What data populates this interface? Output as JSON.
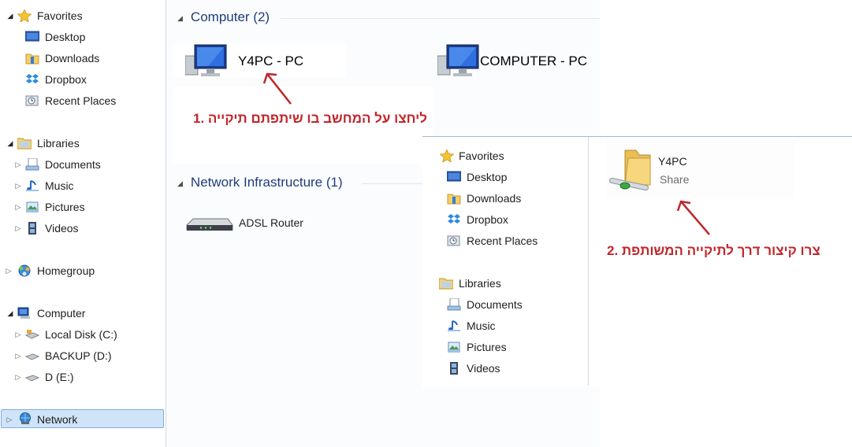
{
  "nav": {
    "favorites": {
      "label": "Favorites",
      "items": [
        "Desktop",
        "Downloads",
        "Dropbox",
        "Recent Places"
      ]
    },
    "libraries": {
      "label": "Libraries",
      "items": [
        "Documents",
        "Music",
        "Pictures",
        "Videos"
      ]
    },
    "homegroup": "Homegroup",
    "computer": {
      "label": "Computer",
      "items": [
        "Local Disk (C:)",
        "BACKUP (D:)",
        "D (E:)"
      ]
    },
    "network": "Network"
  },
  "main": {
    "groups": {
      "computer_header": "Computer (2)",
      "infra_header": "Network Infrastructure (1)"
    },
    "computers": [
      "Y4PC - PC",
      "COMPUTER - PC"
    ],
    "router": "ADSL Router",
    "annotation_1": "1. ליחצו על המחשב בו שיתפתם תיקייה"
  },
  "overlay": {
    "favorites": {
      "label": "Favorites",
      "items": [
        "Desktop",
        "Downloads",
        "Dropbox",
        "Recent Places"
      ]
    },
    "libraries": {
      "label": "Libraries",
      "items": [
        "Documents",
        "Music",
        "Pictures",
        "Videos"
      ]
    },
    "share": {
      "name": "Y4PC",
      "type": "Share"
    },
    "annotation_2": "2. צרו קיצור דרך לתיקייה המשותפת"
  },
  "colors": {
    "annotation": "#c0262b",
    "group_header": "#1f3c7a",
    "selection": "#cfe4f8"
  }
}
